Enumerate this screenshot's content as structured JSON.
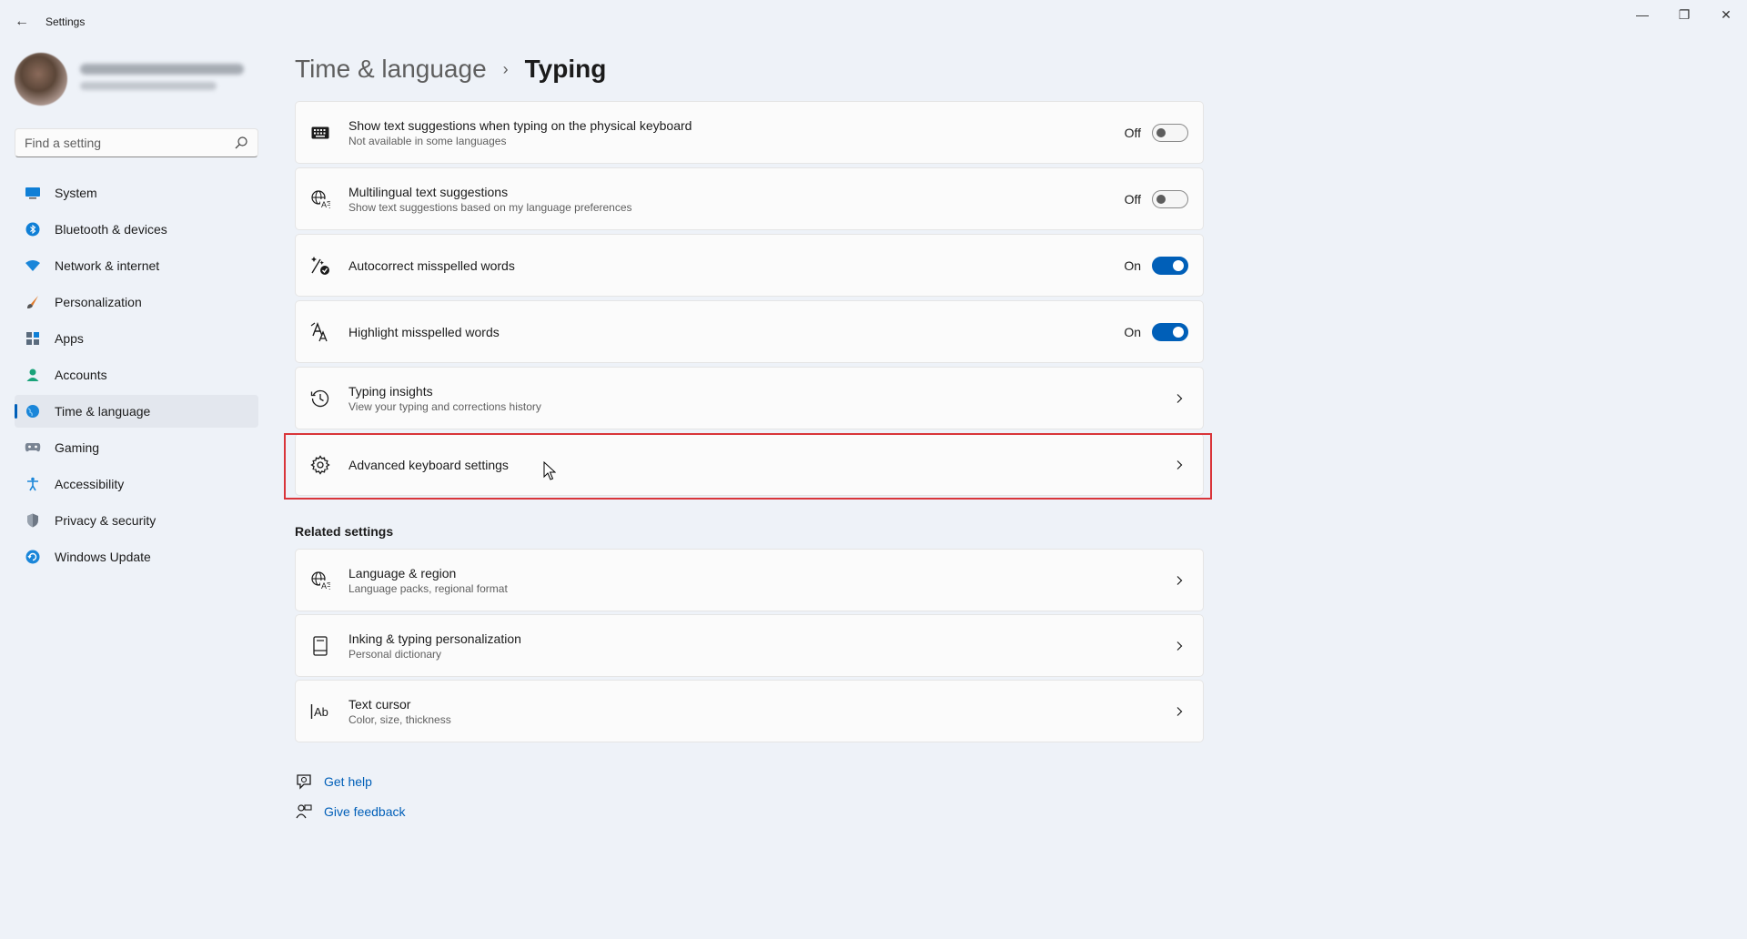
{
  "window": {
    "title": "Settings",
    "back_glyph": "←",
    "min_glyph": "—",
    "max_glyph": "❐",
    "close_glyph": "✕"
  },
  "search": {
    "placeholder": "Find a setting"
  },
  "sidebar": {
    "items": [
      {
        "label": "System",
        "icon": "system-icon"
      },
      {
        "label": "Bluetooth & devices",
        "icon": "bluetooth-icon"
      },
      {
        "label": "Network & internet",
        "icon": "wifi-icon"
      },
      {
        "label": "Personalization",
        "icon": "brush-icon"
      },
      {
        "label": "Apps",
        "icon": "apps-icon"
      },
      {
        "label": "Accounts",
        "icon": "person-icon"
      },
      {
        "label": "Time & language",
        "icon": "globe-clock-icon",
        "active": true
      },
      {
        "label": "Gaming",
        "icon": "gamepad-icon"
      },
      {
        "label": "Accessibility",
        "icon": "accessibility-icon"
      },
      {
        "label": "Privacy & security",
        "icon": "shield-icon"
      },
      {
        "label": "Windows Update",
        "icon": "update-icon"
      }
    ]
  },
  "breadcrumb": {
    "parent": "Time & language",
    "separator": "›",
    "current": "Typing"
  },
  "settings": [
    {
      "title": "Show text suggestions when typing on the physical keyboard",
      "subtitle": "Not available in some languages",
      "state": "Off",
      "control": "toggle",
      "on": false,
      "icon": "keyboard-icon"
    },
    {
      "title": "Multilingual text suggestions",
      "subtitle": "Show text suggestions based on my language preferences",
      "state": "Off",
      "control": "toggle",
      "on": false,
      "icon": "language-icon"
    },
    {
      "title": "Autocorrect misspelled words",
      "subtitle": "",
      "state": "On",
      "control": "toggle",
      "on": true,
      "icon": "autocorrect-icon"
    },
    {
      "title": "Highlight misspelled words",
      "subtitle": "",
      "state": "On",
      "control": "toggle",
      "on": true,
      "icon": "spellcheck-icon"
    },
    {
      "title": "Typing insights",
      "subtitle": "View your typing and corrections history",
      "control": "link",
      "icon": "history-icon"
    },
    {
      "title": "Advanced keyboard settings",
      "subtitle": "",
      "control": "link",
      "icon": "gear-icon",
      "highlighted": true
    }
  ],
  "related": {
    "heading": "Related settings",
    "items": [
      {
        "title": "Language & region",
        "subtitle": "Language packs, regional format",
        "icon": "language-icon"
      },
      {
        "title": "Inking & typing personalization",
        "subtitle": "Personal dictionary",
        "icon": "dictionary-icon"
      },
      {
        "title": "Text cursor",
        "subtitle": "Color, size, thickness",
        "icon": "text-cursor-icon"
      }
    ]
  },
  "help": {
    "get_help": "Get help",
    "give_feedback": "Give feedback"
  },
  "colors": {
    "accent": "#005fb8",
    "highlight": "#d9353a",
    "background": "#eef2f8"
  }
}
